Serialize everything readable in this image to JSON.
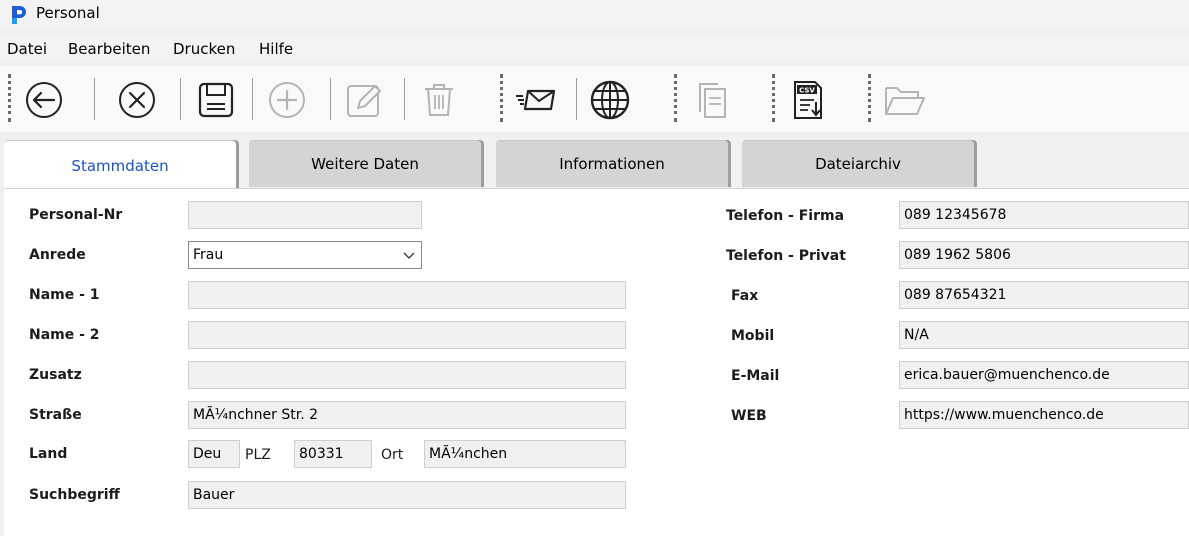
{
  "window": {
    "title": "Personal"
  },
  "menu": [
    "Datei",
    "Bearbeiten",
    "Drucken",
    "Hilfe"
  ],
  "toolbar": [
    "back-icon",
    "cancel-icon",
    "save-icon",
    "add-icon",
    "edit-icon",
    "delete-icon",
    "email-icon",
    "web-icon",
    "copy-icon",
    "csv-export-icon",
    "open-folder-icon"
  ],
  "csv_label": "CSV",
  "tabs": [
    "Stammdaten",
    "Weitere Daten",
    "Informationen",
    "Dateiarchiv"
  ],
  "form": {
    "labels": {
      "personal_nr": "Personal-Nr",
      "anrede": "Anrede",
      "name1": "Name - 1",
      "name2": "Name - 2",
      "zusatz": "Zusatz",
      "strasse": "Straße",
      "land": "Land",
      "plz": "PLZ",
      "ort": "Ort",
      "suchbegriff": "Suchbegriff",
      "tel_firma": "Telefon - Firma",
      "tel_privat": "Telefon - Privat",
      "fax": "Fax",
      "mobil": "Mobil",
      "email": "E-Mail",
      "web": "WEB"
    },
    "values": {
      "personal_nr": "",
      "anrede": "Frau",
      "name1": "",
      "name2": "",
      "zusatz": "",
      "strasse": "MÃ¼nchner Str. 2",
      "land": "Deu",
      "plz": "80331",
      "ort": "MÃ¼nchen",
      "suchbegriff": "Bauer",
      "tel_firma": "089 12345678",
      "tel_privat": "089 1962 5806",
      "fax": "089 87654321",
      "mobil": "N/A",
      "email": "erica.bauer@muenchenco.de",
      "web": "https://www.muenchenco.de"
    }
  }
}
